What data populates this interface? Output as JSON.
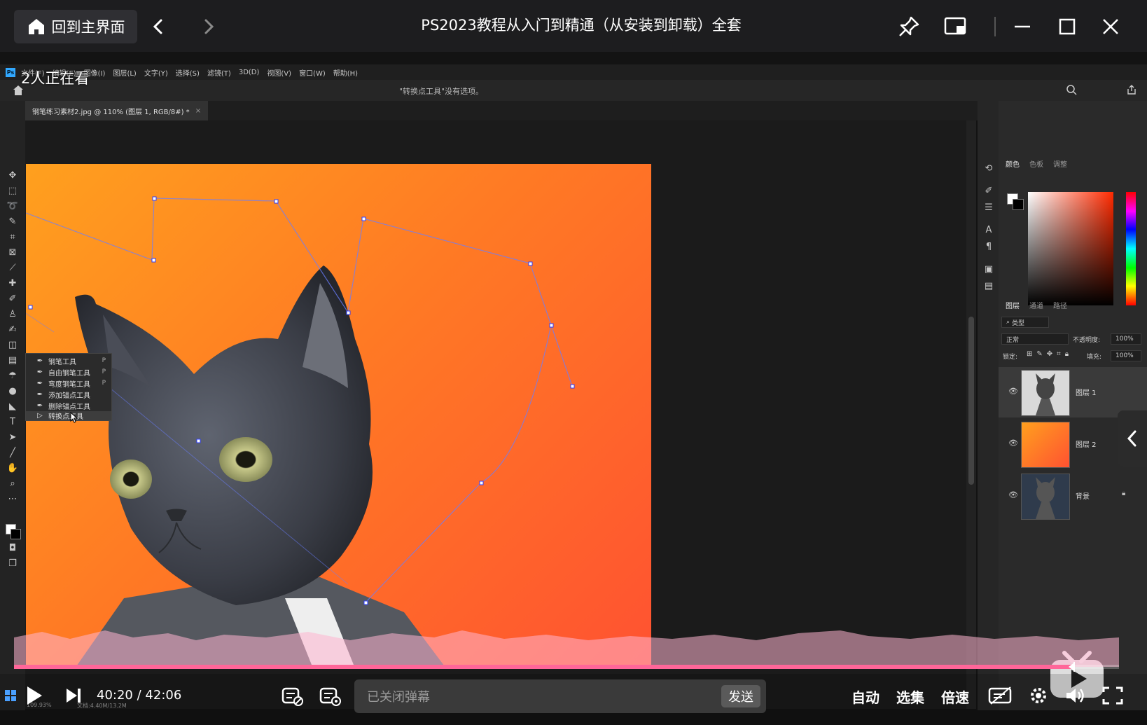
{
  "titlebar": {
    "home_label": "回到主界面",
    "video_title": "PS2023教程从入门到精通（从安装到卸载）全套"
  },
  "overlay": {
    "viewers": "2人正在看"
  },
  "ps": {
    "logo": "Ps",
    "menus": [
      "文件(F)",
      "编辑(E)",
      "图像(I)",
      "图层(L)",
      "文字(Y)",
      "选择(S)",
      "滤镜(T)",
      "3D(D)",
      "视图(V)",
      "窗口(W)",
      "帮助(H)"
    ],
    "options_text": "\"转换点工具\"没有选项。",
    "doc_tab": "钢笔练习素材2.jpg @ 110% (图层 1, RGB/8#) *",
    "doc_tab_close": "×",
    "status_zoom": "109.93%",
    "status_doc": "文档:4.40M/13.2M",
    "flyout": [
      {
        "label": "钢笔工具",
        "key": "P"
      },
      {
        "label": "自由钢笔工具",
        "key": "P"
      },
      {
        "label": "弯度钢笔工具",
        "key": "P"
      },
      {
        "label": "添加锚点工具",
        "key": ""
      },
      {
        "label": "删除锚点工具",
        "key": ""
      },
      {
        "label": "转换点工具",
        "key": ""
      }
    ],
    "color_tabs": [
      "颜色",
      "色板",
      "调整"
    ],
    "layer_tabs": [
      "图层",
      "通道",
      "路径"
    ],
    "layer_filter": "类型",
    "blend_mode": "正常",
    "opacity_label": "不透明度:",
    "opacity_value": "100%",
    "lock_label": "锁定:",
    "fill_label": "填充:",
    "fill_value": "100%",
    "layers": [
      {
        "name": "图层 1",
        "locked": false,
        "selected": true
      },
      {
        "name": "图层 2",
        "locked": false,
        "selected": false
      },
      {
        "name": "背景",
        "locked": true,
        "selected": false
      }
    ]
  },
  "player": {
    "time_current": "40:20",
    "time_sep": "/",
    "time_total": "42:06",
    "progress_fraction": 0.958,
    "danmaku_placeholder": "已关闭弹幕",
    "send_label": "发送",
    "auto_label": "自动",
    "episodes_label": "选集",
    "speed_label": "倍速"
  },
  "colors": {
    "accent_pink": "#ff6699",
    "canvas_left": "#ffa01e",
    "canvas_right": "#ff5231",
    "ps_blue": "#31a8ff"
  }
}
